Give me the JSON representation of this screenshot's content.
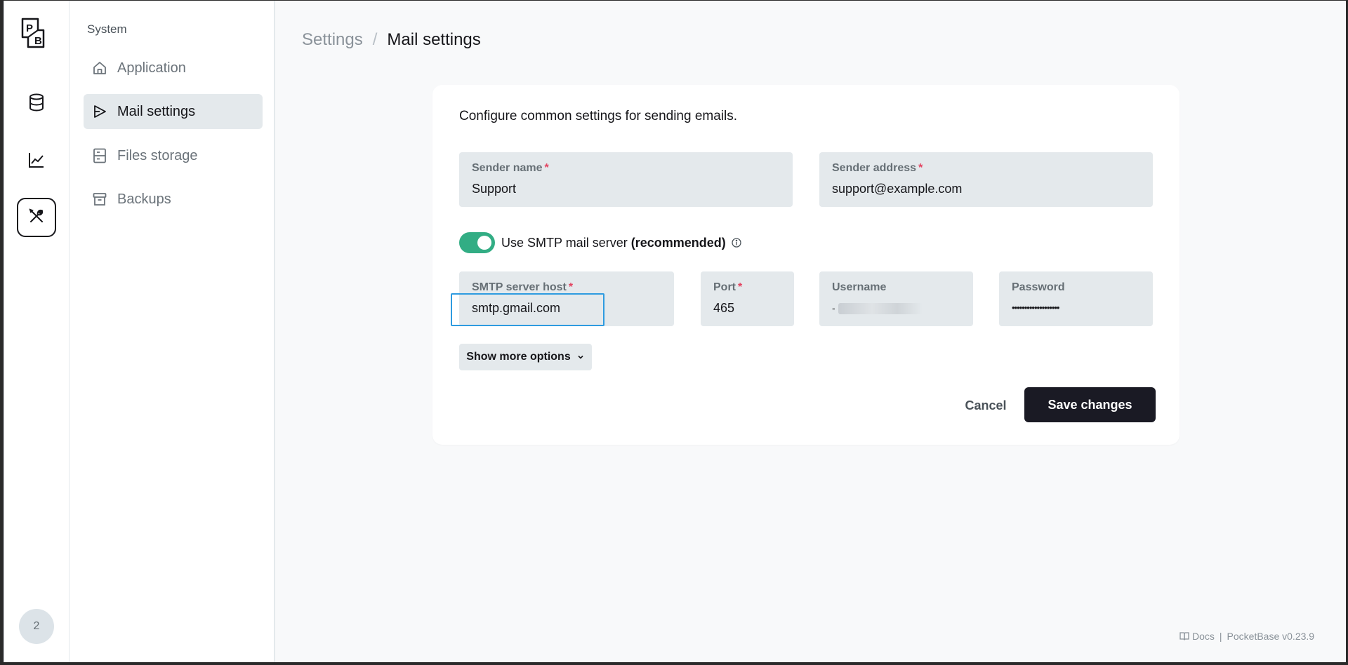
{
  "appbar": {
    "logo_text_top": "P",
    "logo_text_bottom": "B",
    "items": [
      {
        "name": "collections",
        "icon": "database-icon"
      },
      {
        "name": "logs",
        "icon": "chart-line-icon"
      },
      {
        "name": "settings",
        "icon": "tools-icon"
      }
    ],
    "avatar_label": "2"
  },
  "sidebar": {
    "title": "System",
    "items": [
      {
        "label": "Application",
        "icon": "home-icon"
      },
      {
        "label": "Mail settings",
        "icon": "send-icon"
      },
      {
        "label": "Files storage",
        "icon": "storage-icon"
      },
      {
        "label": "Backups",
        "icon": "archive-icon"
      }
    ]
  },
  "breadcrumb": {
    "root": "Settings",
    "separator": "/",
    "current": "Mail settings"
  },
  "form": {
    "description": "Configure common settings for sending emails.",
    "sender_name": {
      "label": "Sender name",
      "required": "*",
      "value": "Support"
    },
    "sender_address": {
      "label": "Sender address",
      "required": "*",
      "value": "support@example.com"
    },
    "smtp_toggle": {
      "label": "Use SMTP mail server",
      "label_bold": "(recommended)",
      "enabled": true
    },
    "smtp_host": {
      "label": "SMTP server host",
      "required": "*",
      "value": "smtp.gmail.com"
    },
    "port": {
      "label": "Port",
      "required": "*",
      "value": "465"
    },
    "username": {
      "label": "Username",
      "value": "-"
    },
    "password": {
      "label": "Password",
      "value": "•••••••••••••••••••"
    },
    "show_more": "Show more options",
    "cancel": "Cancel",
    "save": "Save changes"
  },
  "footer": {
    "docs": "Docs",
    "separator": "|",
    "version": "PocketBase v0.23.9"
  },
  "colors": {
    "accent_toggle": "#32ad84",
    "required": "#e34562",
    "focus": "#2e9be0",
    "primary_button": "#1a1a24"
  }
}
